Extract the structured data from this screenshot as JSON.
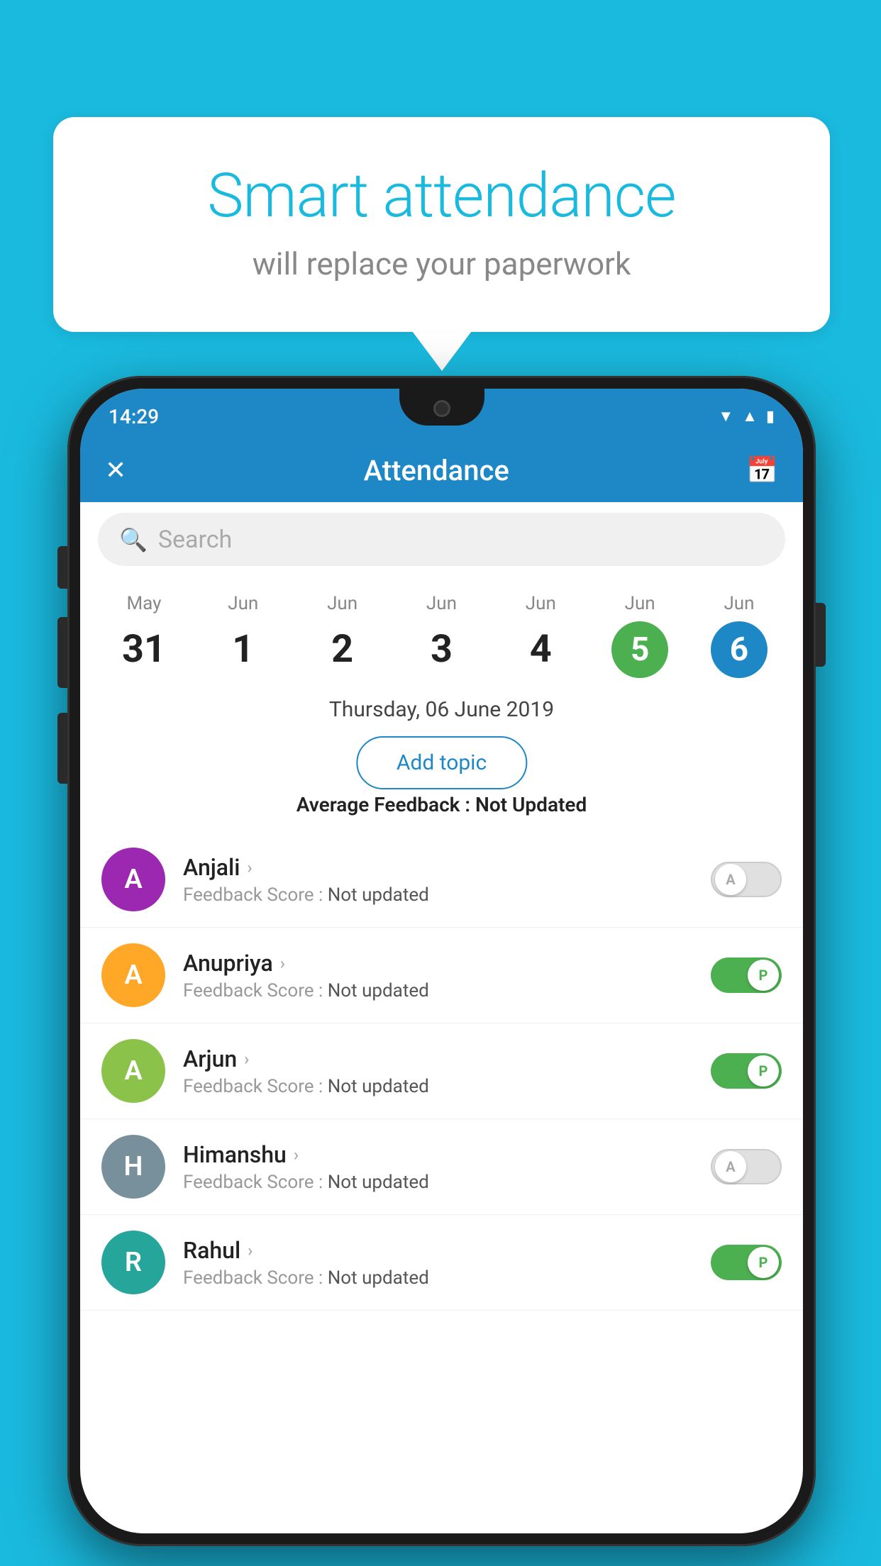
{
  "background_color": "#1ABADF",
  "speech_bubble": {
    "title": "Smart attendance",
    "subtitle": "will replace your paperwork"
  },
  "status_bar": {
    "time": "14:29",
    "icons": [
      "wifi",
      "signal",
      "battery"
    ]
  },
  "header": {
    "title": "Attendance",
    "close_label": "✕",
    "calendar_label": "📅"
  },
  "search": {
    "placeholder": "Search"
  },
  "calendar": {
    "days": [
      {
        "month": "May",
        "num": "31",
        "state": "normal"
      },
      {
        "month": "Jun",
        "num": "1",
        "state": "normal"
      },
      {
        "month": "Jun",
        "num": "2",
        "state": "normal"
      },
      {
        "month": "Jun",
        "num": "3",
        "state": "normal"
      },
      {
        "month": "Jun",
        "num": "4",
        "state": "normal"
      },
      {
        "month": "Jun",
        "num": "5",
        "state": "today"
      },
      {
        "month": "Jun",
        "num": "6",
        "state": "selected"
      }
    ],
    "selected_date": "Thursday, 06 June 2019"
  },
  "add_topic_label": "Add topic",
  "average_feedback": {
    "label": "Average Feedback : ",
    "value": "Not Updated"
  },
  "students": [
    {
      "name": "Anjali",
      "initial": "A",
      "avatar_color": "#9C27B0",
      "score_label": "Feedback Score : ",
      "score_value": "Not updated",
      "toggle": "off",
      "toggle_letter": "A"
    },
    {
      "name": "Anupriya",
      "initial": "A",
      "avatar_color": "#FFA726",
      "score_label": "Feedback Score : ",
      "score_value": "Not updated",
      "toggle": "on",
      "toggle_letter": "P"
    },
    {
      "name": "Arjun",
      "initial": "A",
      "avatar_color": "#8BC34A",
      "score_label": "Feedback Score : ",
      "score_value": "Not updated",
      "toggle": "on",
      "toggle_letter": "P"
    },
    {
      "name": "Himanshu",
      "initial": "H",
      "avatar_color": "#78909C",
      "score_label": "Feedback Score : ",
      "score_value": "Not updated",
      "toggle": "off",
      "toggle_letter": "A"
    },
    {
      "name": "Rahul",
      "initial": "R",
      "avatar_color": "#26A69A",
      "score_label": "Feedback Score : ",
      "score_value": "Not updated",
      "toggle": "on",
      "toggle_letter": "P"
    }
  ]
}
